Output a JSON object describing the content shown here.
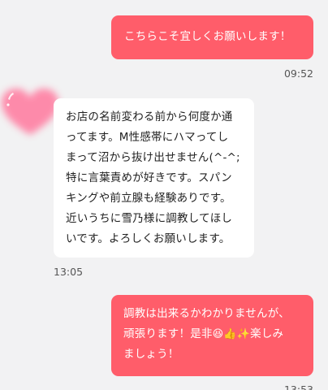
{
  "messages": [
    {
      "direction": "out",
      "text": "こちらこそ宜しくお願いします！",
      "time": "09:52"
    },
    {
      "direction": "in",
      "text": "お店の名前変わる前から何度か通\nってます。M性感帯にハマってし\nまって沼から抜け出せません(^-^;\n特に言葉責めが好きです。スパン\nキングや前立腺も経験ありです。\n近いうちに雪乃様に調教してほし\nいです。よろしくお願いします。",
      "time": "13:05"
    },
    {
      "direction": "out",
      "line1": "調教は出来るかわかりませんが、",
      "line2_before": "頑張ります！是非",
      "emoji1": "😆",
      "emoji2": "👍",
      "emoji3": "✨",
      "line2_after": "楽しみ",
      "line3": "ましょう！",
      "time": "13:53"
    }
  ],
  "colors": {
    "outgoing_bubble": "#ff5d6a",
    "incoming_bubble": "#ffffff",
    "background": "#f2f2f3"
  },
  "avatar": {
    "icon": "heart-icon"
  }
}
